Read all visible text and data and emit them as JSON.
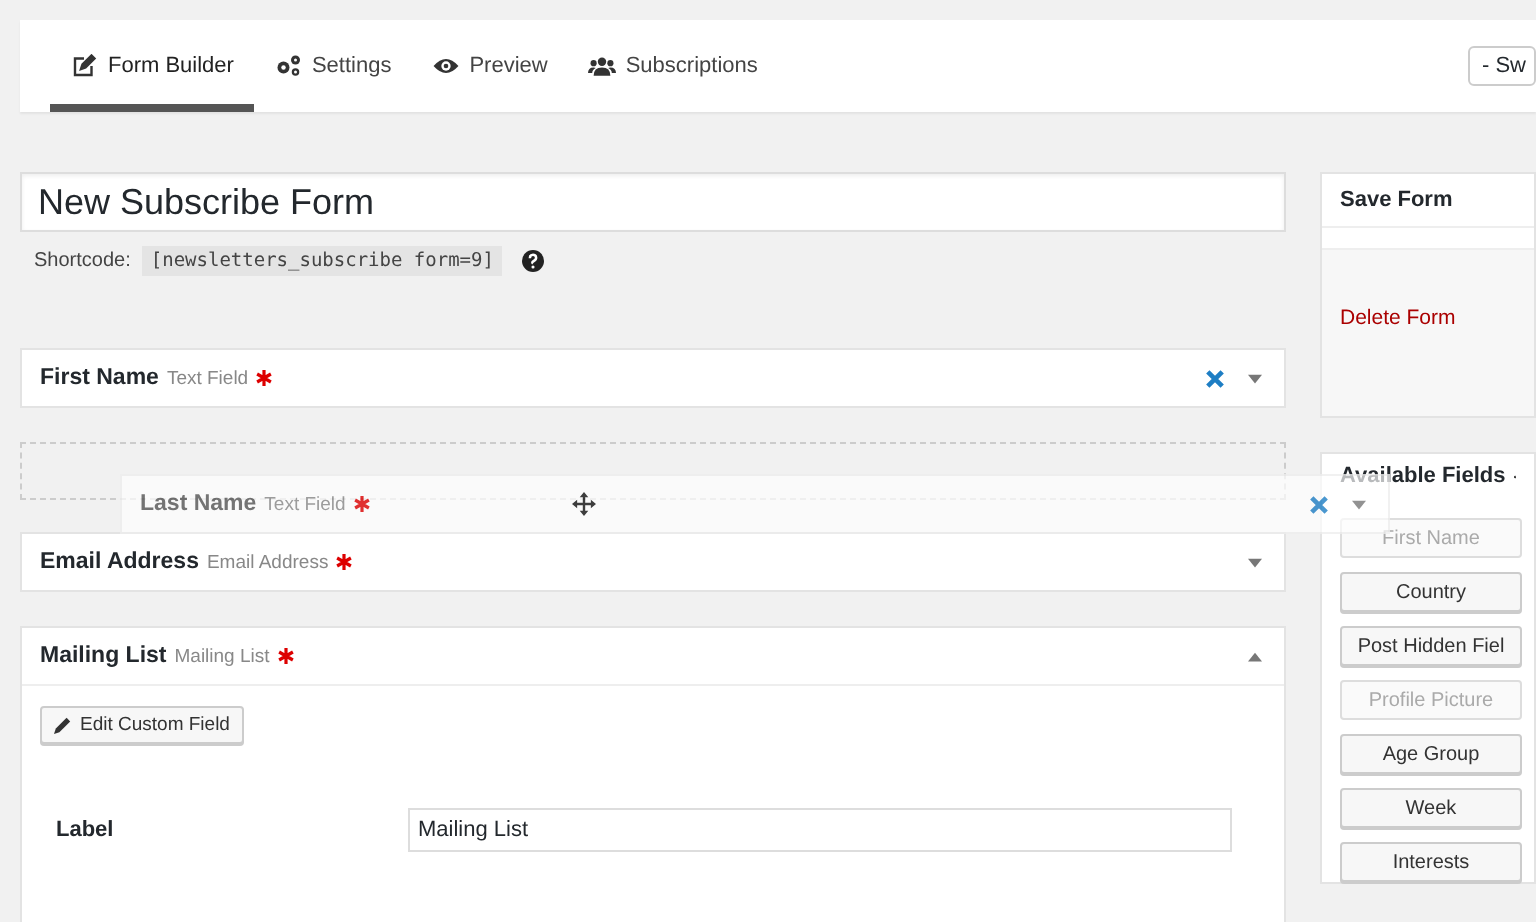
{
  "tabs": [
    {
      "label": "Form Builder",
      "selected": true
    },
    {
      "label": "Settings",
      "selected": false
    },
    {
      "label": "Preview",
      "selected": false
    },
    {
      "label": "Subscriptions",
      "selected": false
    }
  ],
  "switcher": {
    "value": "- Sw"
  },
  "form_title": {
    "value": "New Subscribe Form"
  },
  "shortcode": {
    "label": "Shortcode:",
    "code": "[newsletters_subscribe form=9]"
  },
  "fields": [
    {
      "name": "First Name",
      "type": "Text Field",
      "required": true,
      "removable": true,
      "expanded": false,
      "dragging": false
    },
    {
      "name": "Last Name",
      "type": "Text Field",
      "required": true,
      "removable": true,
      "expanded": false,
      "dragging": true
    },
    {
      "name": "Email Address",
      "type": "Email Address",
      "required": true,
      "removable": false,
      "expanded": false,
      "dragging": false
    },
    {
      "name": "Mailing List",
      "type": "Mailing List",
      "required": true,
      "removable": false,
      "expanded": true,
      "dragging": false,
      "edit_button": "Edit Custom Field",
      "settings": [
        {
          "label": "Label",
          "value": "Mailing List"
        }
      ]
    }
  ],
  "save_box": {
    "title": "Save Form",
    "delete_link": "Delete Form"
  },
  "available_fields": {
    "title": "Available Fields",
    "items": [
      {
        "label": "First Name",
        "disabled": true
      },
      {
        "label": "Country",
        "disabled": false
      },
      {
        "label": "Post Hidden Fiel",
        "disabled": false
      },
      {
        "label": "Profile Picture",
        "disabled": true
      },
      {
        "label": "Age Group",
        "disabled": false
      },
      {
        "label": "Week",
        "disabled": false
      },
      {
        "label": "Interests",
        "disabled": false
      }
    ]
  }
}
